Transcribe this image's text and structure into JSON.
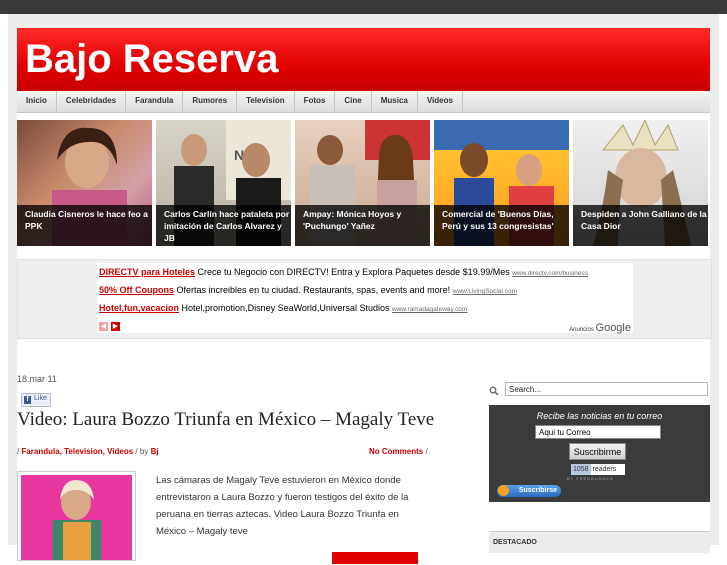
{
  "site": {
    "title": "Bajo Reserva"
  },
  "nav": {
    "items": [
      "Inicio",
      "Celebridades",
      "Farandula",
      "Rumores",
      "Television",
      "Fotos",
      "Cine",
      "Musica",
      "Videos"
    ]
  },
  "slides": [
    {
      "caption": "Claudia Cisneros le hace feo a PPK"
    },
    {
      "caption": "Carlos Carlín hace pataleta por imitación de Carlos Alvarez y JB"
    },
    {
      "caption": "Ampay: Mónica Hoyos y 'Puchungo' Yañez"
    },
    {
      "caption": "Comercial de 'Buenos Días, Perú y sus 13 congresistas'"
    },
    {
      "caption": "Despiden a John Galliano de la Casa Dior"
    }
  ],
  "ads": {
    "lines": [
      {
        "title": "DIRECTV para Hoteles",
        "text": "Crece tu Negocio con DIRECTV! Entra y Explora Paquetes desde $19.99/Mes",
        "url": "www.directv.com/business"
      },
      {
        "title": "50% Off Coupons",
        "text": "Ofertas increibles en tu ciudad. Restaurants, spas, events and more!",
        "url": "www.LivingSocial.com"
      },
      {
        "title": "Hotel,fun,vacacion",
        "text": "Hotel,promotion,Disney SeaWorld,Universal Studios",
        "url": "www.ramadagateway.com"
      }
    ],
    "adsby_label": "Anuncios",
    "google": "Google"
  },
  "post": {
    "date": "18.mar 11",
    "like": "Like",
    "title": "Video: Laura Bozzo Triunfa en México – Magaly Teve",
    "categories": "Farandula, Television, Videos",
    "by": "by",
    "author": "Bj",
    "comments": "No Comments",
    "text": "Las cámaras de Magaly Teve estuvieron en México donde entrevistaron a Laura Bozzo y fueron testigos del éxito de la peruana en tierras aztecas. Video Laura Bozzo Triunfa en México – Magaly teve"
  },
  "sidebar": {
    "search_placeholder": "Search...",
    "subscribe_title": "Recibe las noticias en tu correo",
    "email_value": "Aqui tu Correo",
    "subscribe_button": "Suscribirme",
    "readers_count": "1058",
    "readers_label": "readers",
    "feedburner": "BY FEEDBURNER",
    "rss_button": "Suscribirse",
    "destacado": "DESTACADO"
  },
  "colors": {
    "brand_red": "#e00000",
    "dark": "#3b3b3b"
  }
}
